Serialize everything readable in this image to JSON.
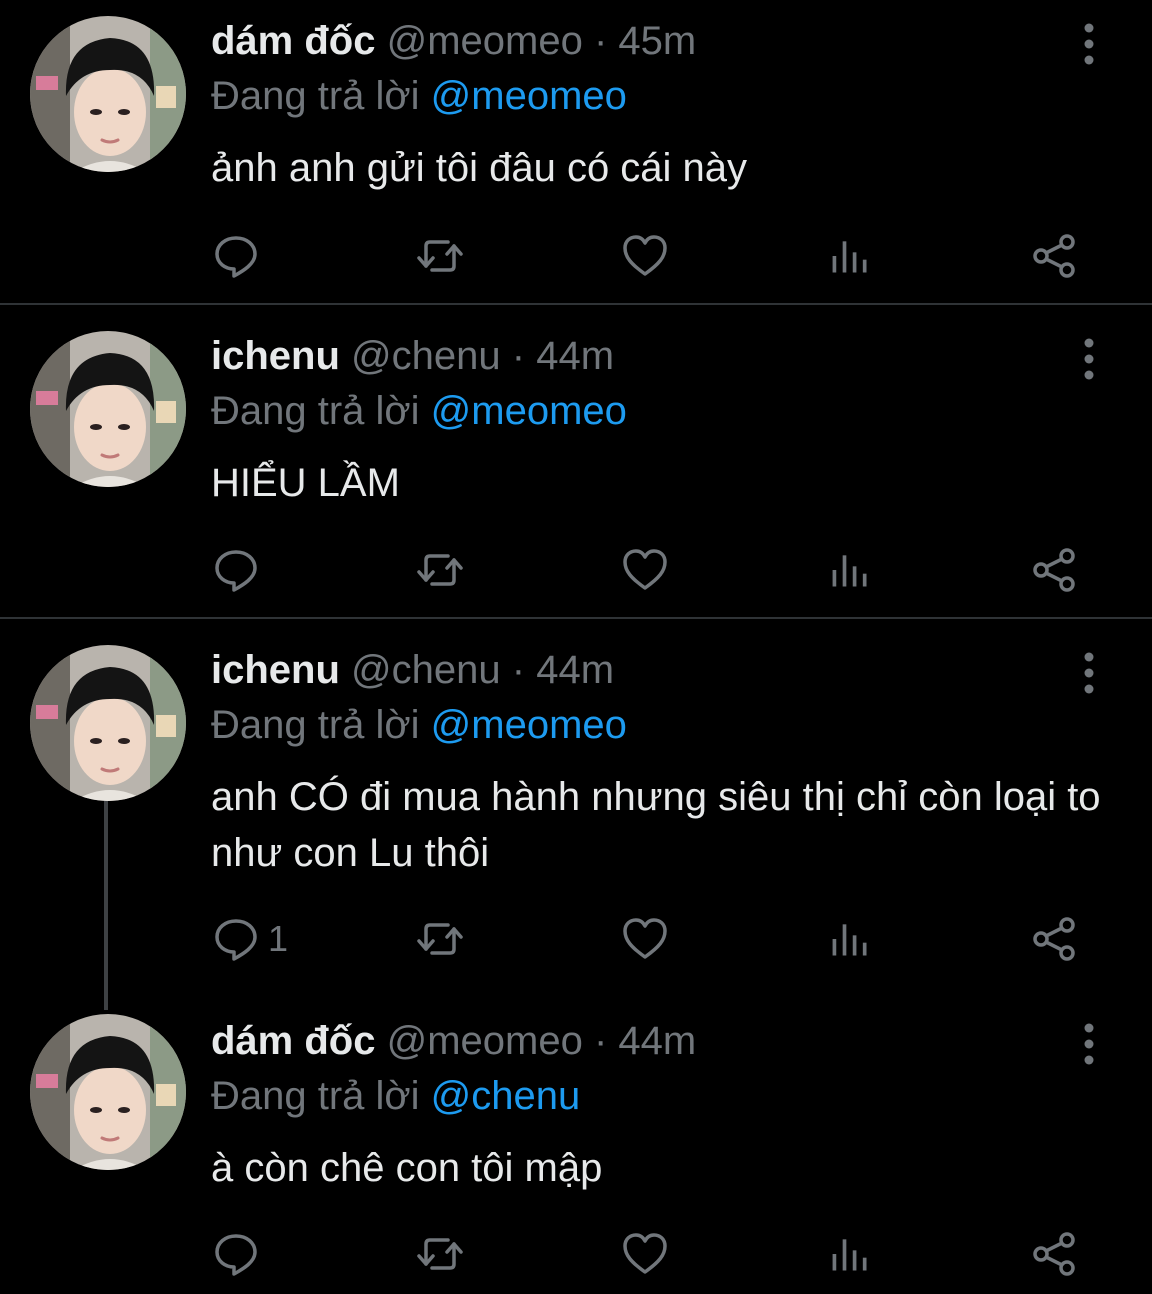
{
  "colors": {
    "background": "#000000",
    "primary_text": "#e7e9ea",
    "secondary_text": "#71767b",
    "accent": "#1d9bf0",
    "divider": "#2f3336"
  },
  "tweets": [
    {
      "name": "dám đốc",
      "handle": "@meomeo",
      "separator": "·",
      "time": "45m",
      "reply_prefix": "Đang trả lời",
      "reply_to": "@meomeo",
      "text": "ảnh anh gửi tôi đâu có cái này",
      "reply_count": "",
      "avatar_icon": "profile-photo"
    },
    {
      "name": "ichenu",
      "handle": "@chenu",
      "separator": "·",
      "time": "44m",
      "reply_prefix": "Đang trả lời",
      "reply_to": "@meomeo",
      "text": "HIỂU LẦM",
      "reply_count": "",
      "avatar_icon": "profile-photo"
    },
    {
      "name": "ichenu",
      "handle": "@chenu",
      "separator": "·",
      "time": "44m",
      "reply_prefix": "Đang trả lời",
      "reply_to": "@meomeo",
      "text": "anh CÓ đi mua hành nhưng siêu thị chỉ còn loại to như con Lu thôi",
      "reply_count": "1",
      "avatar_icon": "profile-photo"
    },
    {
      "name": "dám đốc",
      "handle": "@meomeo",
      "separator": "·",
      "time": "44m",
      "reply_prefix": "Đang trả lời",
      "reply_to": "@chenu",
      "text": "à còn chê con tôi mập",
      "reply_count": "",
      "avatar_icon": "profile-photo"
    }
  ],
  "action_icons": [
    "reply-icon",
    "retweet-icon",
    "like-icon",
    "views-icon",
    "share-icon"
  ]
}
